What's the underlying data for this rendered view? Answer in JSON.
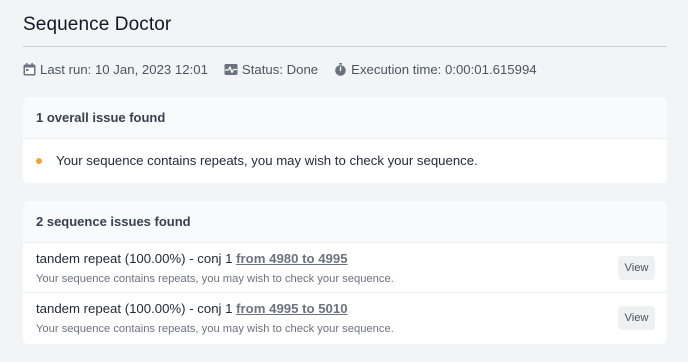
{
  "page": {
    "title": "Sequence Doctor"
  },
  "meta": {
    "last_run": "Last run: 10 Jan, 2023 12:01",
    "status": "Status: Done",
    "execution_time": "Execution time: 0:00:01.615994"
  },
  "overall": {
    "header": "1 overall issue found",
    "issues": [
      {
        "text": "Your sequence contains repeats, you may wish to check your sequence.",
        "dot_color": "#f0a23b"
      }
    ]
  },
  "sequence": {
    "header": "2 sequence issues found",
    "items": [
      {
        "title": "tandem repeat (100.00%) - conj 1",
        "link": "from 4980 to 4995",
        "description": "Your sequence contains repeats, you may wish to check your sequence.",
        "button": "View"
      },
      {
        "title": "tandem repeat (100.00%) - conj 1",
        "link": "from 4995 to 5010",
        "description": "Your sequence contains repeats, you may wish to check your sequence.",
        "button": "View"
      }
    ]
  },
  "icons": {
    "last_run": "calendar-icon",
    "status": "heartbeat-icon",
    "execution_time": "stopwatch-icon"
  }
}
